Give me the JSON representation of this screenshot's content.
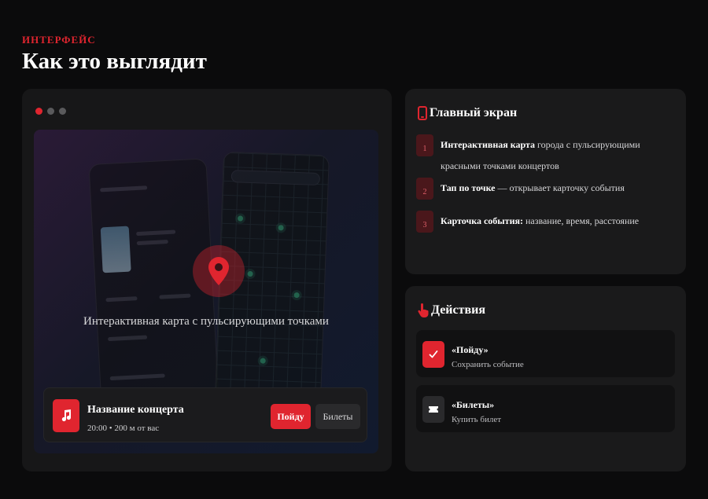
{
  "section": {
    "eyebrow": "ИНТЕРФЕЙС",
    "title": "Как это выглядит"
  },
  "demo": {
    "map_caption": "Интерактивная карта с пульсирующими точками",
    "concert": {
      "name": "Название концерта",
      "meta": "20:00 • 200 м от вас",
      "go_label": "Пойду",
      "tickets_label": "Билеты"
    }
  },
  "main_screen": {
    "title": "Главный экран",
    "steps": [
      {
        "num": "1",
        "bold": "Интерактивная карта",
        "text": " города с пульсирующими красными точками концертов"
      },
      {
        "num": "2",
        "bold": "Тап по точке",
        "text": " — открывает карточку события"
      },
      {
        "num": "3",
        "bold": "Карточка события:",
        "text": " название, время, расстояние"
      }
    ]
  },
  "actions": {
    "title": "Действия",
    "items": [
      {
        "title": "«Пойду»",
        "subtitle": "Сохранить событие"
      },
      {
        "title": "«Билеты»",
        "subtitle": "Купить билет"
      }
    ]
  },
  "colors": {
    "accent": "#e0252f",
    "background": "#0b0b0c",
    "card": "#1a1a1b"
  }
}
